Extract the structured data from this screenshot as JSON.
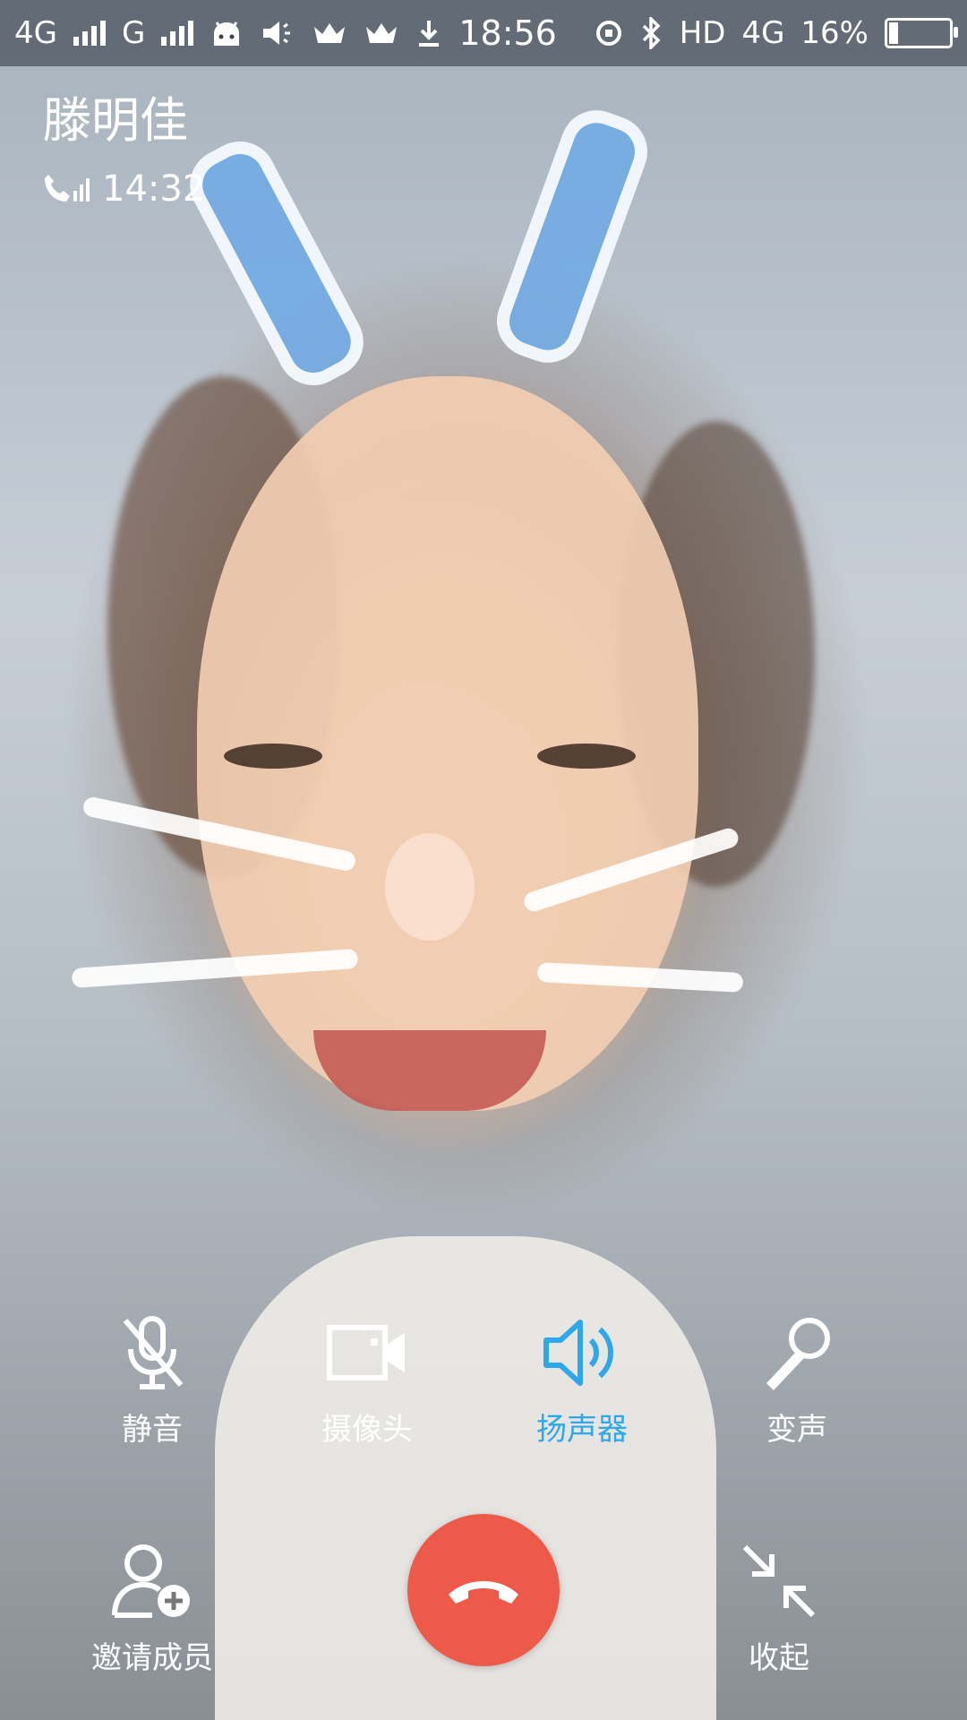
{
  "status_bar": {
    "network1": "4G",
    "network2": "G",
    "time": "18:56",
    "hd_label": "HD",
    "network3": "4G",
    "battery": "16%",
    "battery_level": 0.16
  },
  "call": {
    "caller_name": "滕明佳",
    "duration": "14:32"
  },
  "controls": {
    "mute": "静音",
    "camera": "摄像头",
    "speaker": "扬声器",
    "voice_change": "变声",
    "invite": "邀请成员",
    "collapse": "收起"
  },
  "colors": {
    "active": "#2ea8e8",
    "end_call": "#ee5a4a"
  },
  "icons": {
    "mute": "mic-off-icon",
    "camera": "video-camera-icon",
    "speaker": "speaker-icon",
    "voice_change": "microphone-icon",
    "invite": "add-person-icon",
    "collapse": "collapse-icon",
    "end_call": "phone-hangup-icon"
  }
}
